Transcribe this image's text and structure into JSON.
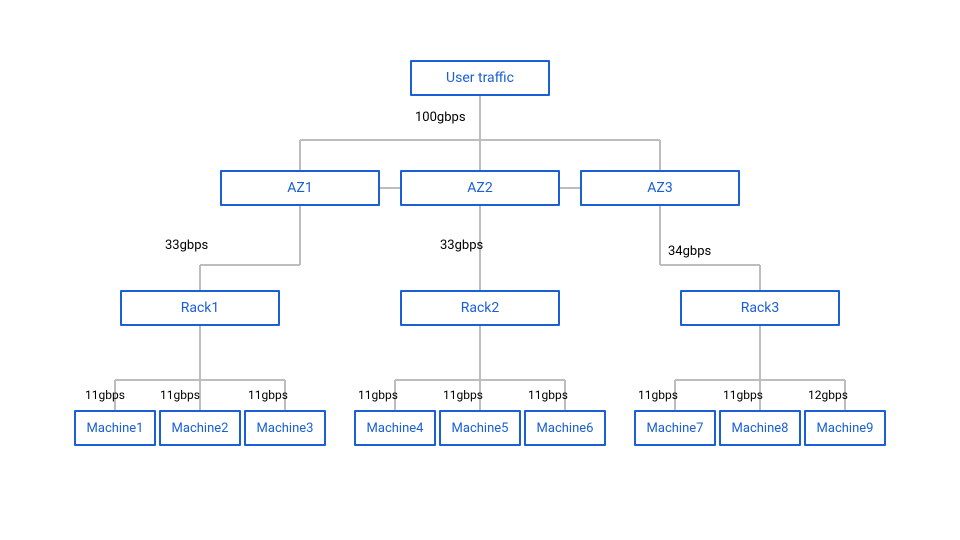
{
  "root": {
    "label": "User traffic"
  },
  "root_to_az_label": "100gbps",
  "azs": [
    {
      "label": "AZ1"
    },
    {
      "label": "AZ2"
    },
    {
      "label": "AZ3"
    }
  ],
  "az_to_rack_labels": [
    "33gbps",
    "33gbps",
    "34gbps"
  ],
  "racks": [
    {
      "label": "Rack1"
    },
    {
      "label": "Rack2"
    },
    {
      "label": "Rack3"
    }
  ],
  "machines": [
    {
      "label": "Machine1"
    },
    {
      "label": "Machine2"
    },
    {
      "label": "Machine3"
    },
    {
      "label": "Machine4"
    },
    {
      "label": "Machine5"
    },
    {
      "label": "Machine6"
    },
    {
      "label": "Machine7"
    },
    {
      "label": "Machine8"
    },
    {
      "label": "Machine9"
    }
  ],
  "rack_to_machine_labels": [
    "11gbps",
    "11gbps",
    "11gbps",
    "11gbps",
    "11gbps",
    "11gbps",
    "11gbps",
    "11gbps",
    "12gbps"
  ]
}
